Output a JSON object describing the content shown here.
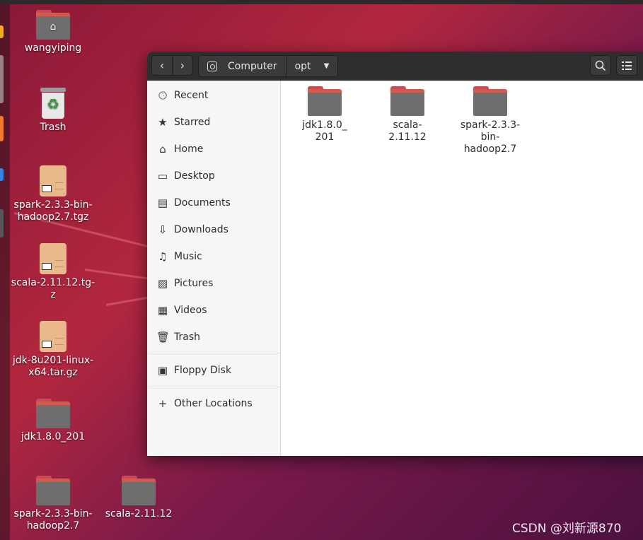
{
  "desktop": {
    "items": [
      {
        "label": "wangyiping",
        "icon": "home-folder-icon"
      },
      {
        "label": "Trash",
        "icon": "trash-icon"
      },
      {
        "label": "spark-2.3.3-bin-hadoop2.7.tgz",
        "icon": "archive-icon"
      },
      {
        "label": "scala-2.11.12.tg-z",
        "icon": "archive-icon"
      },
      {
        "label": "jdk-8u201-linux-x64.tar.gz",
        "icon": "archive-icon"
      },
      {
        "label": "jdk1.8.0_201",
        "icon": "folder-icon"
      },
      {
        "label": "spark-2.3.3-bin-hadoop2.7",
        "icon": "folder-icon"
      },
      {
        "label": "scala-2.11.12",
        "icon": "folder-icon"
      }
    ]
  },
  "files_window": {
    "path": [
      "Computer",
      "opt"
    ],
    "sidebar": {
      "places": [
        {
          "label": "Recent",
          "icon": "clock-icon"
        },
        {
          "label": "Starred",
          "icon": "star-icon"
        },
        {
          "label": "Home",
          "icon": "home-icon"
        },
        {
          "label": "Desktop",
          "icon": "desktop-icon"
        },
        {
          "label": "Documents",
          "icon": "document-icon"
        },
        {
          "label": "Downloads",
          "icon": "download-icon"
        },
        {
          "label": "Music",
          "icon": "music-icon"
        },
        {
          "label": "Pictures",
          "icon": "picture-icon"
        },
        {
          "label": "Videos",
          "icon": "video-icon"
        },
        {
          "label": "Trash",
          "icon": "trash-icon"
        }
      ],
      "devices": [
        {
          "label": "Floppy Disk",
          "icon": "drive-icon"
        }
      ],
      "other": [
        {
          "label": "Other Locations",
          "icon": "plus-icon"
        }
      ]
    },
    "files": [
      {
        "name": "jdk1.8.0_ 201",
        "lines": [
          "jdk1.8.0_",
          "201"
        ]
      },
      {
        "name": "scala- 2.11.12",
        "lines": [
          "scala-",
          "2.11.12"
        ]
      },
      {
        "name": "spark-2.3.3- bin- hadoop2.7",
        "lines": [
          "spark-2.3.3-",
          "bin-",
          "hadoop2.7"
        ]
      }
    ]
  },
  "watermark": "CSDN @刘新源870"
}
